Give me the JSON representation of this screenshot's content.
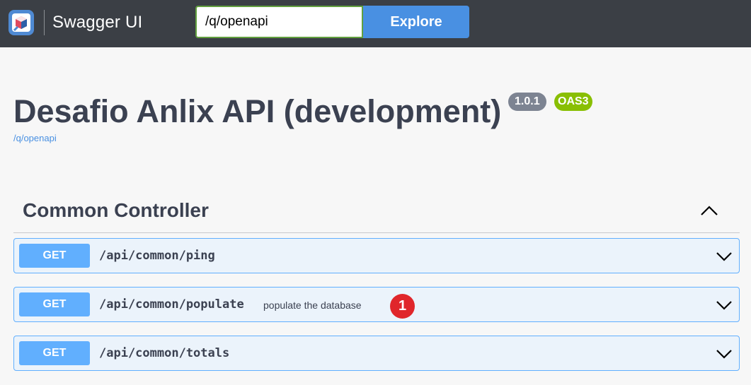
{
  "topbar": {
    "logo_text": "Swagger UI",
    "url_value": "/q/openapi",
    "explore_label": "Explore"
  },
  "info": {
    "title": "Desafio Anlix API (development)",
    "version": "1.0.1",
    "oas": "OAS3",
    "spec_link": "/q/openapi"
  },
  "tag": {
    "name": "Common Controller"
  },
  "operations": [
    {
      "method": "GET",
      "path": "/api/common/ping",
      "summary": ""
    },
    {
      "method": "GET",
      "path": "/api/common/populate",
      "summary": "populate the database",
      "annotation": "1"
    },
    {
      "method": "GET",
      "path": "/api/common/totals",
      "summary": ""
    }
  ],
  "colors": {
    "topbar_bg": "#3b3f45",
    "get_method": "#61affe",
    "get_row_bg": "#ebf3fb",
    "explore_btn": "#4990e2",
    "oas_badge": "#89bf04",
    "version_badge": "#7d8492",
    "annotation_badge": "#e0262b"
  }
}
